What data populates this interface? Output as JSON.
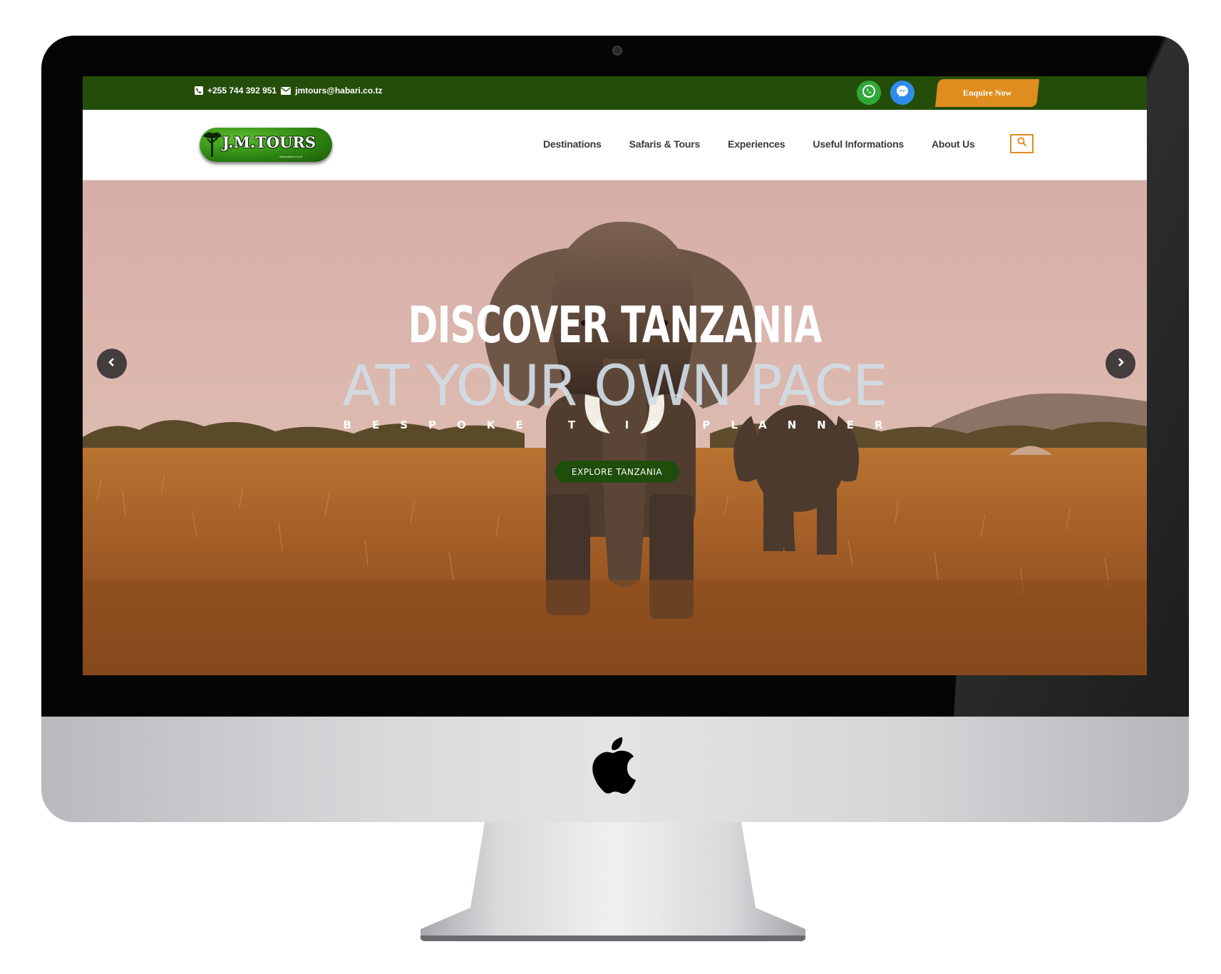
{
  "topbar": {
    "phone": "+255 744 392 951",
    "email": "jmtours@habari.co.tz",
    "enquire_label": "Enquire Now"
  },
  "header": {
    "logo_text": "J.M.TOURS",
    "logo_url": "www.jmtours.co.tz",
    "nav": [
      {
        "label": "Destinations"
      },
      {
        "label": "Safaris & Tours"
      },
      {
        "label": "Experiences"
      },
      {
        "label": "Useful Informations"
      },
      {
        "label": "About Us"
      }
    ]
  },
  "hero": {
    "title": "DISCOVER TANZANIA",
    "subtitle": "AT YOUR OWN PACE",
    "tagline": "BESPOKE TRIP PLANNER",
    "cta_label": "EXPLORE TANZANIA"
  },
  "icons": {
    "phone": "phone-icon",
    "email": "envelope-icon",
    "whatsapp": "whatsapp-icon",
    "messenger": "messenger-icon",
    "search": "search-icon",
    "prev": "chevron-left-icon",
    "next": "chevron-right-icon",
    "apple": "apple-logo-icon"
  },
  "colors": {
    "topbar_green": "#234d08",
    "accent_orange": "#df8d1e",
    "cta_green": "#1f4d0c",
    "whatsapp_green": "#2fa838",
    "messenger_blue": "#2f8de9"
  }
}
